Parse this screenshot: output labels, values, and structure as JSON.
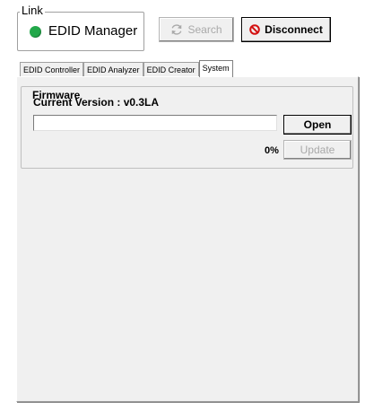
{
  "link": {
    "legend": "Link",
    "device_name": "EDID Manager",
    "status_color": "#22a84a"
  },
  "toolbar": {
    "search_label": "Search",
    "search_icon": "refresh-icon",
    "disconnect_label": "Disconnect",
    "disconnect_icon": "no-entry-icon"
  },
  "tabs": [
    {
      "label": "EDID Controller",
      "active": false
    },
    {
      "label": "EDID Analyzer",
      "active": false
    },
    {
      "label": "EDID Creator",
      "active": false
    },
    {
      "label": "System",
      "active": true
    }
  ],
  "firmware": {
    "legend": "Firmware",
    "current_version": "Current Version : v0.3LA",
    "file_path_value": "",
    "open_label": "Open",
    "progress": "0%",
    "update_label": "Update"
  }
}
